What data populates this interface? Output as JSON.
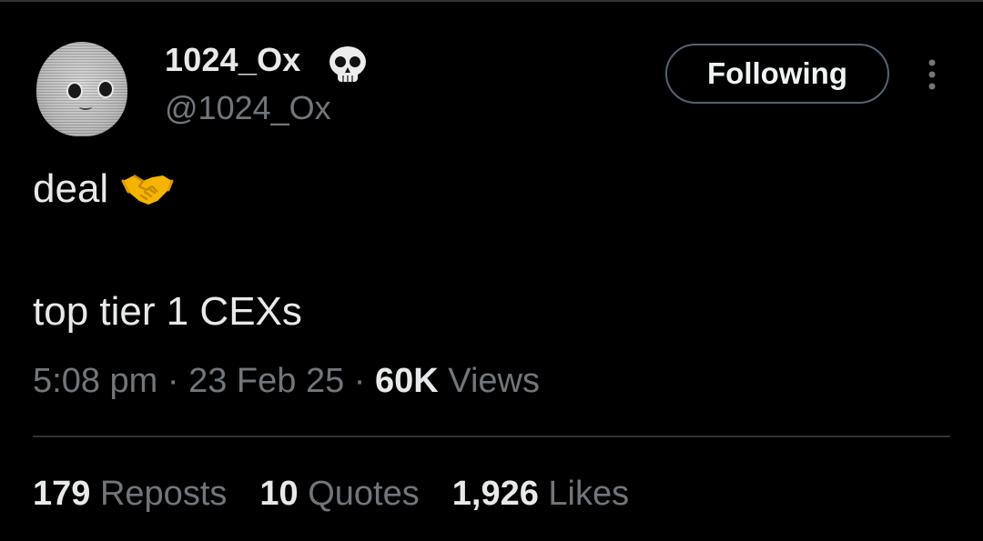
{
  "author": {
    "display_name": "1024_Ox",
    "handle": "@1024_Ox",
    "badge_icon": "skull-icon",
    "avatar_icon": "avatar-icon"
  },
  "follow_button": {
    "label": "Following"
  },
  "more_menu": {
    "icon": "more-vertical-icon"
  },
  "tweet": {
    "line1": "deal",
    "line1_emoji": "handshake-icon",
    "line2": "top tier 1 CEXs"
  },
  "meta": {
    "time": "5:08 pm",
    "separator": "·",
    "date": "23 Feb 25",
    "views_count": "60K",
    "views_label": "Views"
  },
  "stats": {
    "reposts_count": "179",
    "reposts_label": "Reposts",
    "quotes_count": "10",
    "quotes_label": "Quotes",
    "likes_count": "1,926",
    "likes_label": "Likes"
  },
  "colors": {
    "background": "#000000",
    "primary_text": "#e7e9ea",
    "secondary_text": "#71767b",
    "divider": "#2f3336",
    "button_border": "#536471"
  }
}
